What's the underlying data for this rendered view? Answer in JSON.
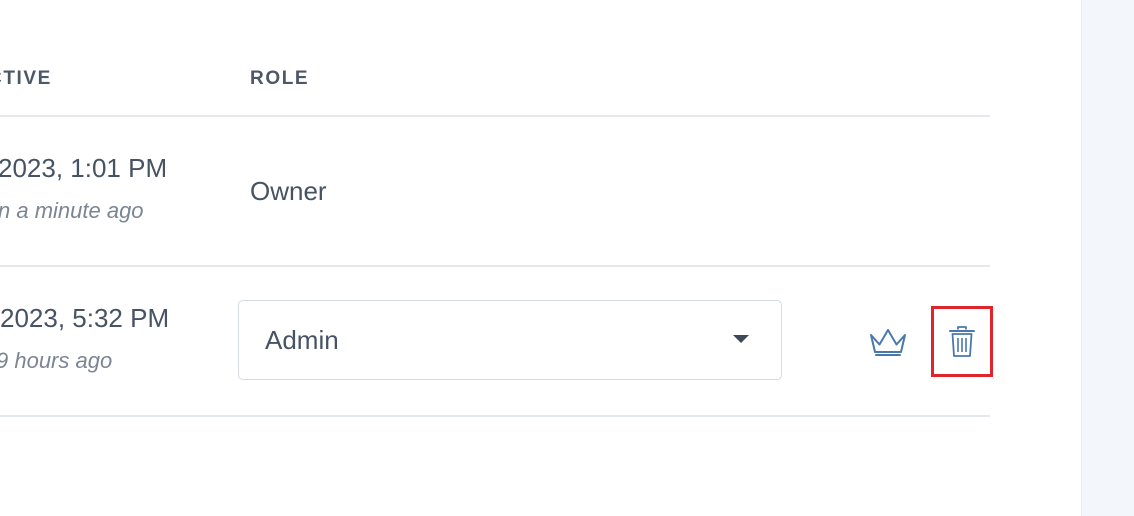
{
  "table": {
    "headers": {
      "last_active": "CTIVE",
      "role": "ROLE"
    },
    "rows": [
      {
        "date": "2023, 1:01 PM",
        "relative": "n a minute ago",
        "role": "Owner"
      },
      {
        "date": "2023, 5:32 PM",
        "relative": "9 hours ago",
        "role_select": "Admin"
      }
    ]
  },
  "icons": {
    "make_owner": "crown-icon",
    "delete": "trash-icon"
  },
  "colors": {
    "icon": "#4a78ad",
    "highlight": "#e0242b",
    "side_panel": "#f3f6fa"
  }
}
